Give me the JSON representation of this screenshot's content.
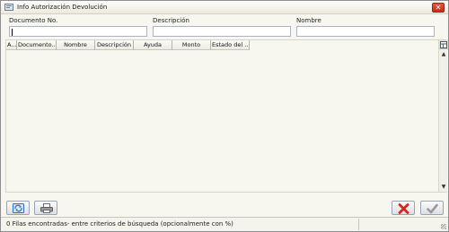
{
  "window": {
    "title": "Info Autorización Devolución",
    "close_symbol": "✕"
  },
  "search": {
    "document_no_label": "Documento No.",
    "document_no_value": "",
    "description_label": "Descripción",
    "description_value": "",
    "name_label": "Nombre",
    "name_value": ""
  },
  "grid": {
    "columns": [
      "A...",
      "Documento...",
      "Nombre",
      "Descripción",
      "Ayuda",
      "Monto",
      "Estado del ..."
    ],
    "rows": []
  },
  "toolbar": {
    "refresh_icon": "refresh-icon",
    "print_icon": "print-icon",
    "cancel_icon": "cancel-icon",
    "ok_icon": "ok-icon"
  },
  "status": {
    "text": "0 Filas encontradas- entre criterios de búsqueda (opcionalmente con %)"
  },
  "colors": {
    "cancel_red": "#d8261b",
    "ok_gray": "#9a9a9a",
    "refresh_blue": "#2f6fb7"
  }
}
